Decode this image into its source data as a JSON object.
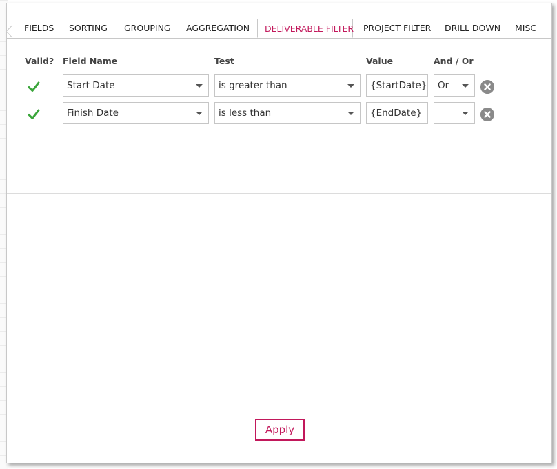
{
  "tabs": [
    {
      "label": "FIELDS"
    },
    {
      "label": "SORTING"
    },
    {
      "label": "GROUPING"
    },
    {
      "label": "AGGREGATION"
    },
    {
      "label": "DELIVERABLE FILTER",
      "active": true
    },
    {
      "label": "PROJECT FILTER"
    },
    {
      "label": "DRILL DOWN"
    },
    {
      "label": "MISC"
    }
  ],
  "columns": {
    "valid": "Valid?",
    "field_name": "Field Name",
    "test": "Test",
    "value": "Value",
    "and_or": "And / Or"
  },
  "rows": [
    {
      "valid": true,
      "field_name": "Start Date",
      "test": "is greater than",
      "value": "{StartDate}",
      "and_or": "Or"
    },
    {
      "valid": true,
      "field_name": "Finish Date",
      "test": "is less than",
      "value": "{EndDate}",
      "and_or": ""
    }
  ],
  "apply_label": "Apply",
  "colors": {
    "accent": "#c2185b",
    "valid_check": "#3aa53a",
    "remove_icon": "#8a8a8a"
  },
  "icons": {
    "valid": "checkmark-icon",
    "remove": "close-circle-icon",
    "dropdown": "caret-down-icon"
  }
}
